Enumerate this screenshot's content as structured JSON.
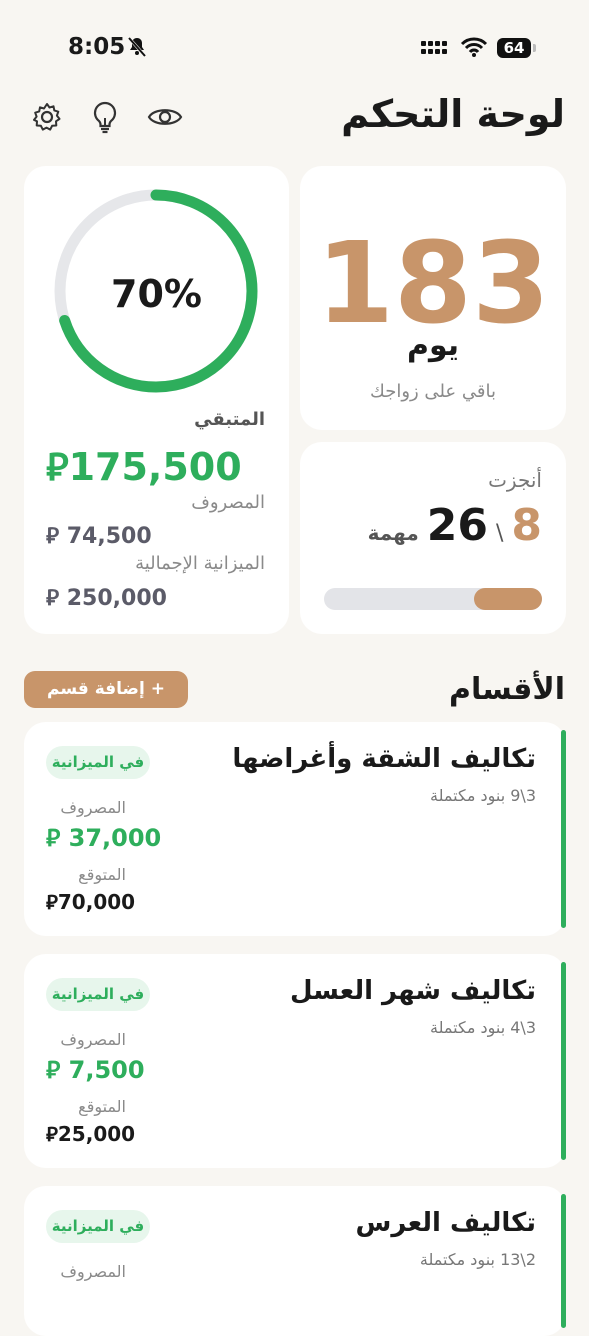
{
  "status_bar": {
    "time": "8:05",
    "battery": "64"
  },
  "header": {
    "title": "لوحة التحكم",
    "icons": [
      "eye-icon",
      "lightbulb-icon",
      "gear-icon"
    ]
  },
  "budget_card": {
    "percent_label": "70%",
    "percent_value": 0.7,
    "remaining_label": "المتبقي",
    "remaining_value": "175,500",
    "spent_label": "المصروف",
    "spent_value": "74,500",
    "total_label": "الميزانية الإجمالية",
    "total_value": "250,000",
    "currency_symbol": "⃁"
  },
  "days_card": {
    "number": "183",
    "unit": "يوم",
    "subtitle": "باقي على زواجك"
  },
  "tasks_card": {
    "label": "أنجزت",
    "done": "8",
    "separator": "\\",
    "total": "26",
    "unit": "مهمة",
    "progress": 0.31
  },
  "sections": {
    "title": "الأقسام",
    "add_button": "+ إضافة قسم",
    "items": [
      {
        "name": "تكاليف الشقة وأغراضها",
        "count": "3\\9 بنود مكتملة",
        "badge": "في الميزانية",
        "spent_label": "المصروف",
        "spent": "37,000",
        "expected_label": "المتوقع",
        "expected": "70,000"
      },
      {
        "name": "تكاليف شهر العسل",
        "count": "3\\4 بنود مكتملة",
        "badge": "في الميزانية",
        "spent_label": "المصروف",
        "spent": "7,500",
        "expected_label": "المتوقع",
        "expected": "25,000"
      },
      {
        "name": "تكاليف العرس",
        "count": "2\\13 بنود مكتملة",
        "badge": "في الميزانية",
        "spent_label": "المصروف"
      }
    ]
  },
  "colors": {
    "accent_green": "#2eae5c",
    "accent_tan": "#c8956a",
    "background": "#f8f6f2"
  }
}
